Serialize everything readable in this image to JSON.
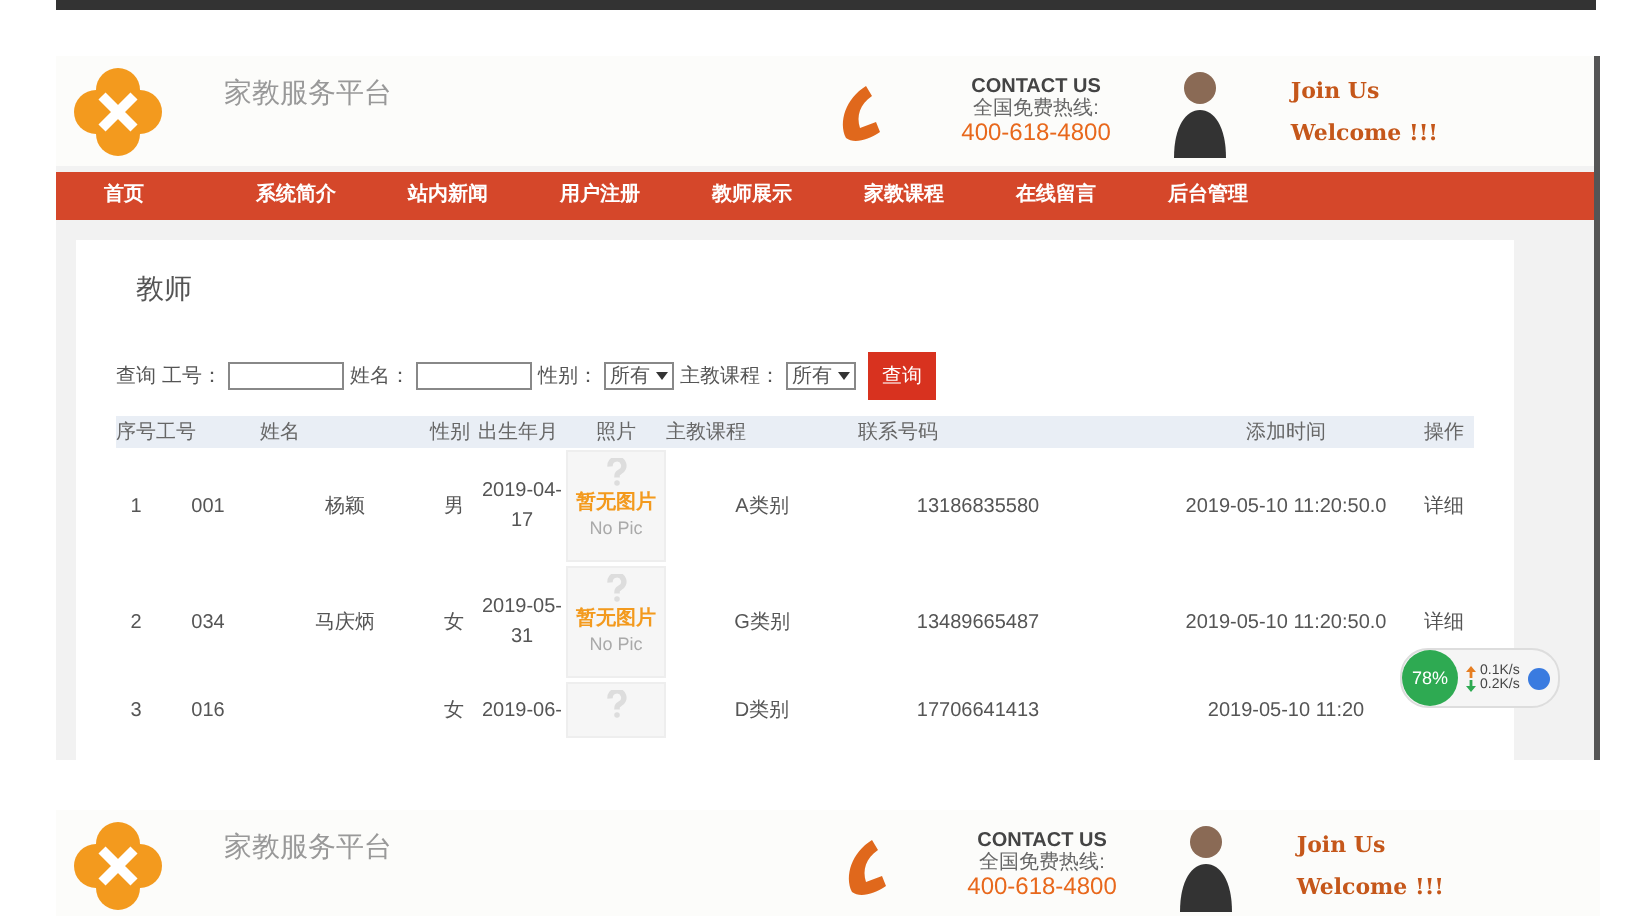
{
  "screens": [
    {
      "header": {
        "site_name": "家教服务平台",
        "contact_title": "CONTACT US",
        "hotline_label": "全国免费热线:",
        "hotline": "400-618-4800",
        "join": "Join Us",
        "welcome": "Welcome !!!"
      },
      "nav": [
        {
          "label": "首页"
        },
        {
          "label": "系统简介"
        },
        {
          "label": "站内新闻"
        },
        {
          "label": "用户注册"
        },
        {
          "label": "教师展示"
        },
        {
          "label": "家教课程"
        },
        {
          "label": "在线留言"
        },
        {
          "label": "后台管理"
        }
      ],
      "page": {
        "title": "教师",
        "search": {
          "label": "查询",
          "fields": [
            {
              "kind": "text",
              "label": "工号："
            },
            {
              "kind": "text",
              "label": "姓名："
            },
            {
              "kind": "select",
              "label": "性别：",
              "value": "所有"
            },
            {
              "kind": "select",
              "label": "主教课程：",
              "value": "所有"
            }
          ],
          "button": "查询"
        },
        "table": {
          "columns": [
            "序号",
            "工号",
            "姓名",
            "性别",
            "出生年月",
            "照片",
            "主教课程",
            "联系号码",
            "",
            "添加时间",
            "操作"
          ],
          "rows": [
            {
              "no": "1",
              "id": "001",
              "name": "杨颖",
              "gender": "男",
              "birth": "2019-04-17",
              "photo": {
                "caption": "暂无图片",
                "note": "No Pic"
              },
              "course": "A类别",
              "phone": "13186835580",
              "added": "2019-05-10 11:20:50.0",
              "action": "详细"
            },
            {
              "no": "2",
              "id": "034",
              "name": "马庆炳",
              "gender": "女",
              "birth": "2019-05-31",
              "photo": {
                "caption": "暂无图片",
                "note": "No Pic"
              },
              "course": "G类别",
              "phone": "13489665487",
              "added": "2019-05-10 11:20:50.0",
              "action": "详细"
            },
            {
              "no": "3",
              "id": "016",
              "name": "",
              "gender": "女",
              "birth": "2019-06-",
              "photo": {},
              "course": "D类别",
              "phone": "17706641413",
              "added": "2019-05-10 11:20",
              "action": ""
            }
          ]
        }
      },
      "speed_widget": {
        "percent": "78%",
        "up": "0.1K/s",
        "down": "0.2K/s"
      }
    },
    {
      "header": {
        "site_name": "家教服务平台",
        "contact_title": "CONTACT US",
        "hotline_label": "全国免费热线:",
        "hotline": "400-618-4800",
        "join": "Join Us",
        "welcome": "Welcome !!!"
      }
    }
  ]
}
